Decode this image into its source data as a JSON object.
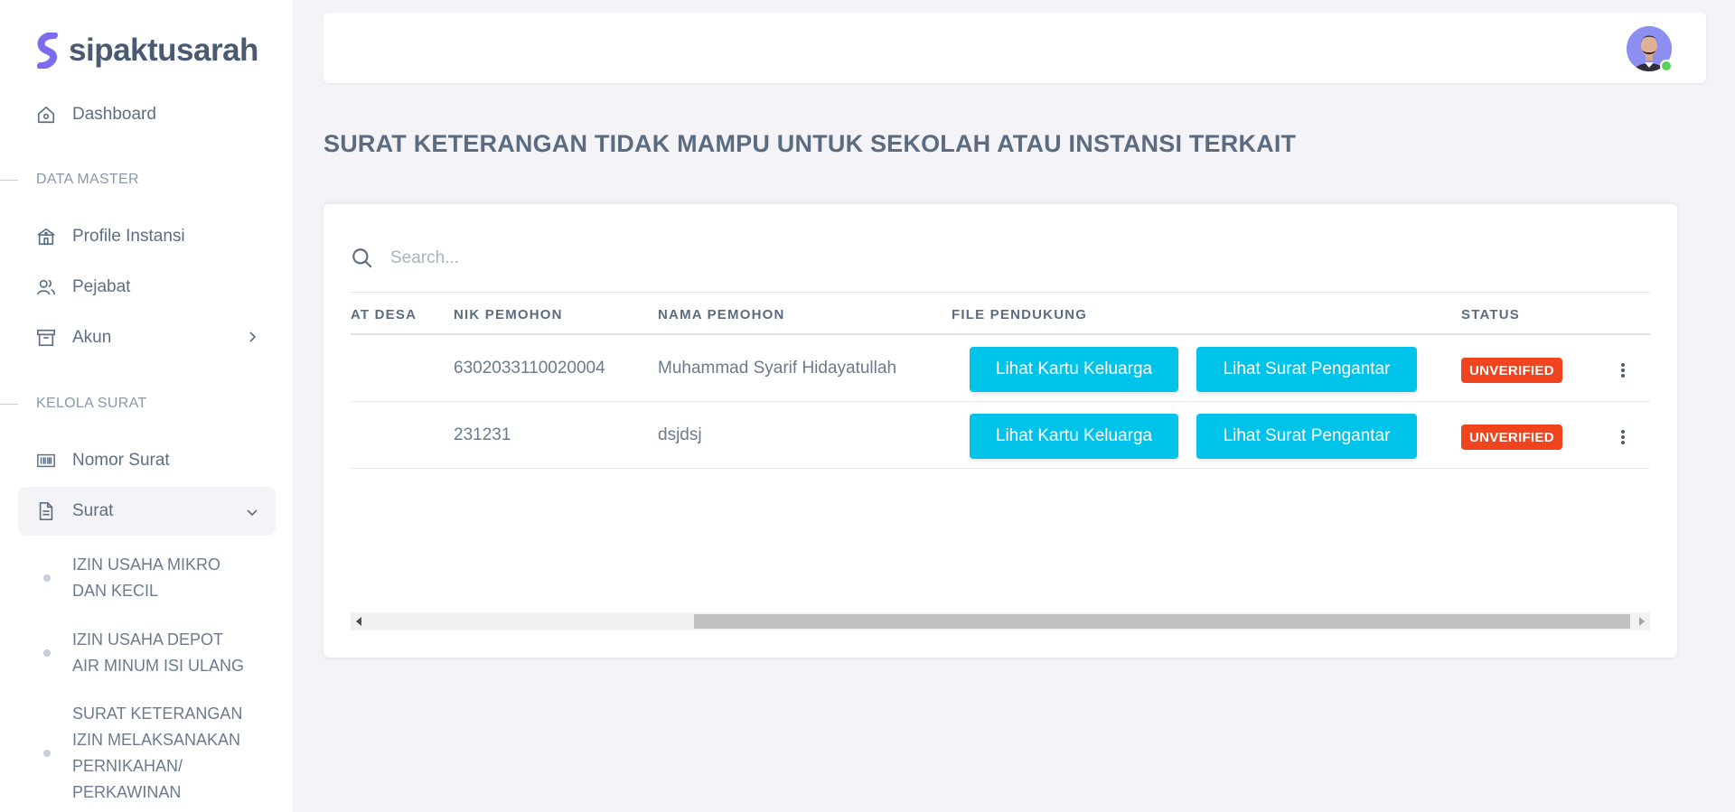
{
  "brand": {
    "name": "sipaktusarah",
    "accent": "#7b6cf0"
  },
  "sidebar": {
    "dashboard": "Dashboard",
    "section_master": "DATA MASTER",
    "profile_instansi": "Profile Instansi",
    "pejabat": "Pejabat",
    "akun": "Akun",
    "section_surat": "KELOLA SURAT",
    "nomor_surat": "Nomor Surat",
    "surat": "Surat",
    "sub_items": [
      {
        "lines": [
          "IZIN USAHA MIKRO",
          "DAN KECIL"
        ]
      },
      {
        "lines": [
          "IZIN USAHA DEPOT",
          "AIR MINUM ISI ULANG"
        ]
      },
      {
        "lines": [
          "SURAT KETERANGAN",
          "IZIN MELAKSANAKAN",
          "PERNIKAHAN/",
          "PERKAWINAN"
        ]
      }
    ]
  },
  "header": {
    "avatar": "user-avatar",
    "online_color": "#5bd15b"
  },
  "main": {
    "title": "SURAT KETERANGAN TIDAK MAMPU UNTUK SEKOLAH ATAU INSTANSI TERKAIT",
    "search_placeholder": "Search...",
    "columns": {
      "alamat_desa": "AT DESA",
      "nik": "NIK PEMOHON",
      "nama": "NAMA PEMOHON",
      "file": "FILE PENDUKUNG",
      "status": "STATUS"
    },
    "rows": [
      {
        "nik": "6302033110020004",
        "nama": "Muhammad Syarif Hidayatullah",
        "btn_kk": "Lihat Kartu Keluarga",
        "btn_pengantar": "Lihat Surat Pengantar",
        "status": "UNVERIFIED"
      },
      {
        "nik": "231231",
        "nama": "dsjdsj",
        "btn_kk": "Lihat Kartu Keluarga",
        "btn_pengantar": "Lihat Surat Pengantar",
        "status": "UNVERIFIED"
      }
    ],
    "colors": {
      "button": "#00c3ea",
      "badge": "#f0441e"
    }
  }
}
